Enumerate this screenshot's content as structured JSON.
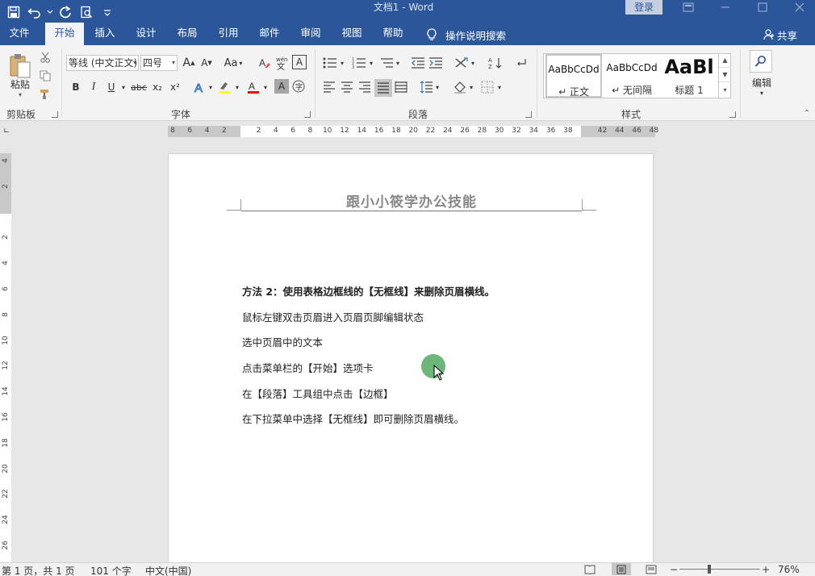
{
  "titlebar": {
    "doc_title": "文档1  -  Word",
    "login": "登录",
    "qat_more": "≡"
  },
  "tabs": [
    {
      "label": "文件"
    },
    {
      "label": "开始"
    },
    {
      "label": "插入"
    },
    {
      "label": "设计"
    },
    {
      "label": "布局"
    },
    {
      "label": "引用"
    },
    {
      "label": "邮件"
    },
    {
      "label": "审阅"
    },
    {
      "label": "视图"
    },
    {
      "label": "帮助"
    }
  ],
  "tell_me": "操作说明搜索",
  "share": "共享",
  "ribbon": {
    "clipboard": {
      "paste": "粘贴",
      "label": "剪贴板"
    },
    "font": {
      "font_name": "等线 (中文正文)",
      "font_size": "四号",
      "grow": "A",
      "shrink": "A",
      "case": "Aa",
      "bold": "B",
      "italic": "I",
      "underline": "U",
      "strike": "abc",
      "sub": "x₂",
      "sup": "x²",
      "label": "字体",
      "highlight_color": "#ffff00",
      "font_color": "#ff0000"
    },
    "paragraph": {
      "label": "段落"
    },
    "styles": {
      "items": [
        {
          "sample": "AaBbCcDd",
          "name": "↵ 正文"
        },
        {
          "sample": "AaBbCcDd",
          "name": "↵ 无间隔"
        },
        {
          "sample": "AaBl",
          "name": "标题 1"
        }
      ],
      "label": "样式"
    },
    "editing": {
      "label": "编辑"
    }
  },
  "ruler": {
    "h_ticks": [
      "8",
      "6",
      "4",
      "2",
      "",
      "2",
      "4",
      "6",
      "8",
      "10",
      "12",
      "14",
      "16",
      "18",
      "20",
      "22",
      "24",
      "26",
      "28",
      "30",
      "32",
      "34",
      "36",
      "38",
      "",
      "42",
      "44",
      "46",
      "48"
    ],
    "v_ticks": [
      "4",
      "2",
      "",
      "2",
      "4",
      "6",
      "8",
      "10",
      "12",
      "14",
      "16",
      "18",
      "20",
      "22",
      "24",
      "26"
    ]
  },
  "document": {
    "header": "跟小小筱学办公技能",
    "lines": [
      {
        "text": "方法 2：使用表格边框线的【无框线】来删除页眉横线。",
        "bold": true
      },
      {
        "text": "鼠标左键双击页眉进入页眉页脚编辑状态",
        "bold": false
      },
      {
        "text": "选中页眉中的文本",
        "bold": false
      },
      {
        "text": "点击菜单栏的【开始】选项卡",
        "bold": false
      },
      {
        "text": "在【段落】工具组中点击【边框】",
        "bold": false
      },
      {
        "text": "在下拉菜单中选择【无框线】即可删除页眉横线。",
        "bold": false
      }
    ]
  },
  "status": {
    "page": "第 1 页，共 1 页",
    "words": "101 个字",
    "language": "中文(中国)",
    "zoom": "76%",
    "zoom_level_percent": 76
  },
  "colors": {
    "title_blue": "#2b579a",
    "cursor_green": "#5cae6a"
  }
}
